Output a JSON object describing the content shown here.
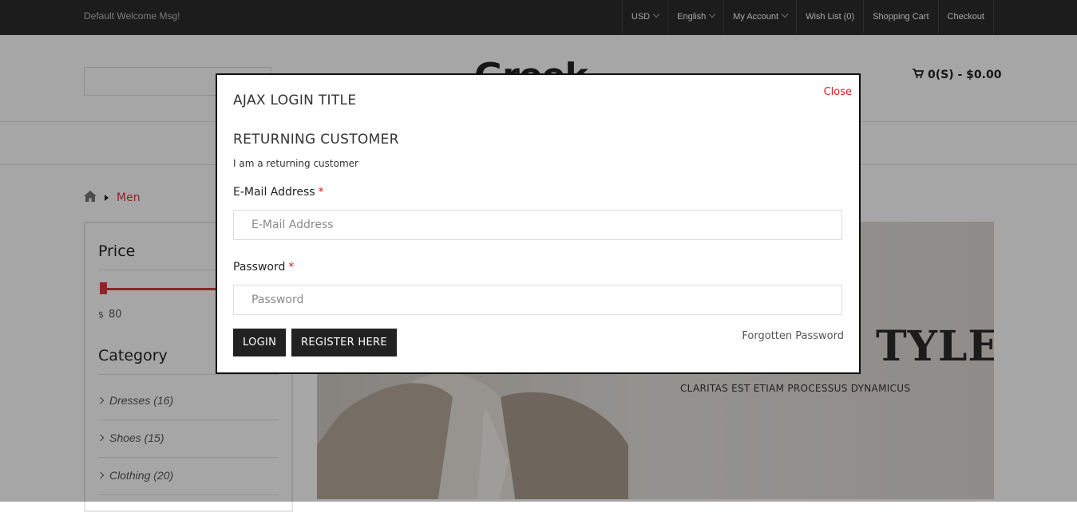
{
  "topbar": {
    "welcome": "Default Welcome Msg!",
    "currency": "USD",
    "language": "English",
    "account": "My Account",
    "wishlist": "Wish List (0)",
    "cart": "Shopping Cart",
    "checkout": "Checkout"
  },
  "header": {
    "logo_text": "Greek",
    "cart_summary": "0(S) - $0.00"
  },
  "breadcrumb": {
    "current": "Men"
  },
  "sidebar": {
    "price_title": "Price",
    "price_currency": "$",
    "price_value": "80",
    "category_title": "Category",
    "categories": [
      {
        "label": "Dresses (16)"
      },
      {
        "label": "Shoes (15)"
      },
      {
        "label": "Clothing (20)"
      }
    ]
  },
  "banner": {
    "title": "TYLE",
    "subtitle": "CLARITAS EST ETIAM PROCESSUS DYNAMICUS"
  },
  "modal": {
    "title": "AJAX LOGIN TITLE",
    "close": "Close",
    "section_title": "RETURNING CUSTOMER",
    "section_sub": "I am a returning customer",
    "email_label": "E-Mail Address",
    "email_placeholder": "E-Mail Address",
    "email_value": "",
    "password_label": "Password",
    "password_placeholder": "Password",
    "password_value": "",
    "required_mark": "*",
    "login_button": "LOGIN",
    "register_button": "REGISTER HERE",
    "forgot_link": "Forgotten Password"
  },
  "colors": {
    "accent": "#d21f1f",
    "topbar_bg": "#2b2b2b",
    "button_bg": "#222222"
  }
}
